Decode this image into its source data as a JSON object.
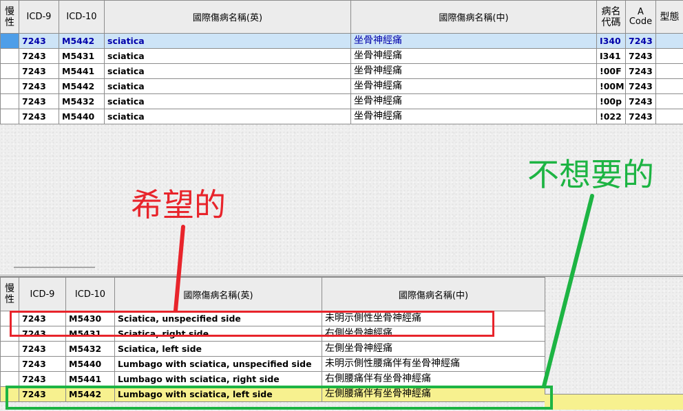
{
  "top_table": {
    "headers": {
      "chronic": "慢性",
      "icd9": "ICD-9",
      "icd10": "ICD-10",
      "name_en": "國際傷病名稱(英)",
      "name_zh": "國際傷病名稱(中)",
      "disease_code": "病名代碼",
      "a_code_a": "A",
      "a_code_b": "Code",
      "type": "型態"
    },
    "rows": [
      {
        "icd9": "7243",
        "icd10": "M5442",
        "name_en": "sciatica",
        "name_zh": "坐骨神經痛",
        "disease_code": "I340",
        "a_code": "7243",
        "selected": true
      },
      {
        "icd9": "7243",
        "icd10": "M5431",
        "name_en": "sciatica",
        "name_zh": "坐骨神經痛",
        "disease_code": "I341",
        "a_code": "7243"
      },
      {
        "icd9": "7243",
        "icd10": "M5441",
        "name_en": "sciatica",
        "name_zh": "坐骨神經痛",
        "disease_code": "!00F",
        "a_code": "7243"
      },
      {
        "icd9": "7243",
        "icd10": "M5442",
        "name_en": "sciatica",
        "name_zh": "坐骨神經痛",
        "disease_code": "!00M",
        "a_code": "7243"
      },
      {
        "icd9": "7243",
        "icd10": "M5432",
        "name_en": "sciatica",
        "name_zh": "坐骨神經痛",
        "disease_code": "!00p",
        "a_code": "7243"
      },
      {
        "icd9": "7243",
        "icd10": "M5440",
        "name_en": "sciatica",
        "name_zh": "坐骨神經痛",
        "disease_code": "!022",
        "a_code": "7243"
      }
    ]
  },
  "bottom_table": {
    "headers": {
      "chronic": "慢性",
      "icd9": "ICD-9",
      "icd10": "ICD-10",
      "name_en": "國際傷病名稱(英)",
      "name_zh": "國際傷病名稱(中)"
    },
    "rows": [
      {
        "icd9": "7243",
        "icd10": "M5430",
        "name_en": "Sciatica, unspecified side",
        "name_zh": "未明示側性坐骨神經痛"
      },
      {
        "icd9": "7243",
        "icd10": "M5431",
        "name_en": "Sciatica, right side",
        "name_zh": "右側坐骨神經痛"
      },
      {
        "icd9": "7243",
        "icd10": "M5432",
        "name_en": "Sciatica, left side",
        "name_zh": "左側坐骨神經痛"
      },
      {
        "icd9": "7243",
        "icd10": "M5440",
        "name_en": "Lumbago with sciatica, unspecified side",
        "name_zh": "未明示側性腰痛伴有坐骨神經痛"
      },
      {
        "icd9": "7243",
        "icd10": "M5441",
        "name_en": "Lumbago with sciatica, right side",
        "name_zh": "右側腰痛伴有坐骨神經痛"
      },
      {
        "icd9": "7243",
        "icd10": "M5442",
        "name_en": "Lumbago with sciatica, left side",
        "name_zh": "左側腰痛伴有坐骨神經痛",
        "highlighted": true
      }
    ]
  },
  "annotations": {
    "wanted": "希望的",
    "unwanted": "不想要的"
  },
  "colors": {
    "selection": "#4e9ee8",
    "highlight_row": "#f7f18f",
    "annotation_red": "#e8242b",
    "annotation_green": "#1db443"
  }
}
